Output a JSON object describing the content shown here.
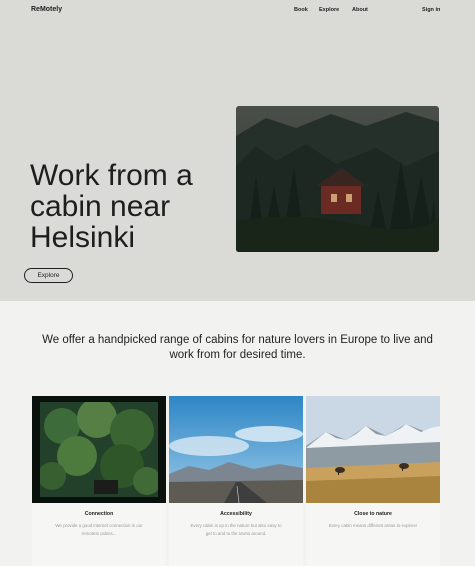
{
  "brand": "ReMotely",
  "nav": {
    "book": "Book",
    "explore": "Explore",
    "about": "About",
    "sign_in": "Sign in"
  },
  "hero": {
    "title": "Work from a cabin near Helsinki",
    "cta": "Explore"
  },
  "tagline": "We offer a handpicked range of cabins for nature lovers in Europe to live and work from for desired time.",
  "cards": [
    {
      "title": "Connection",
      "description": "We provide a good internet connection in our remotest cabins..."
    },
    {
      "title": "Accessibility",
      "description": "Every cabin is up in the nature but also easy to get to and to the towns around."
    },
    {
      "title": "Close to nature",
      "description": "Every cabin means different areas to explore!"
    }
  ]
}
